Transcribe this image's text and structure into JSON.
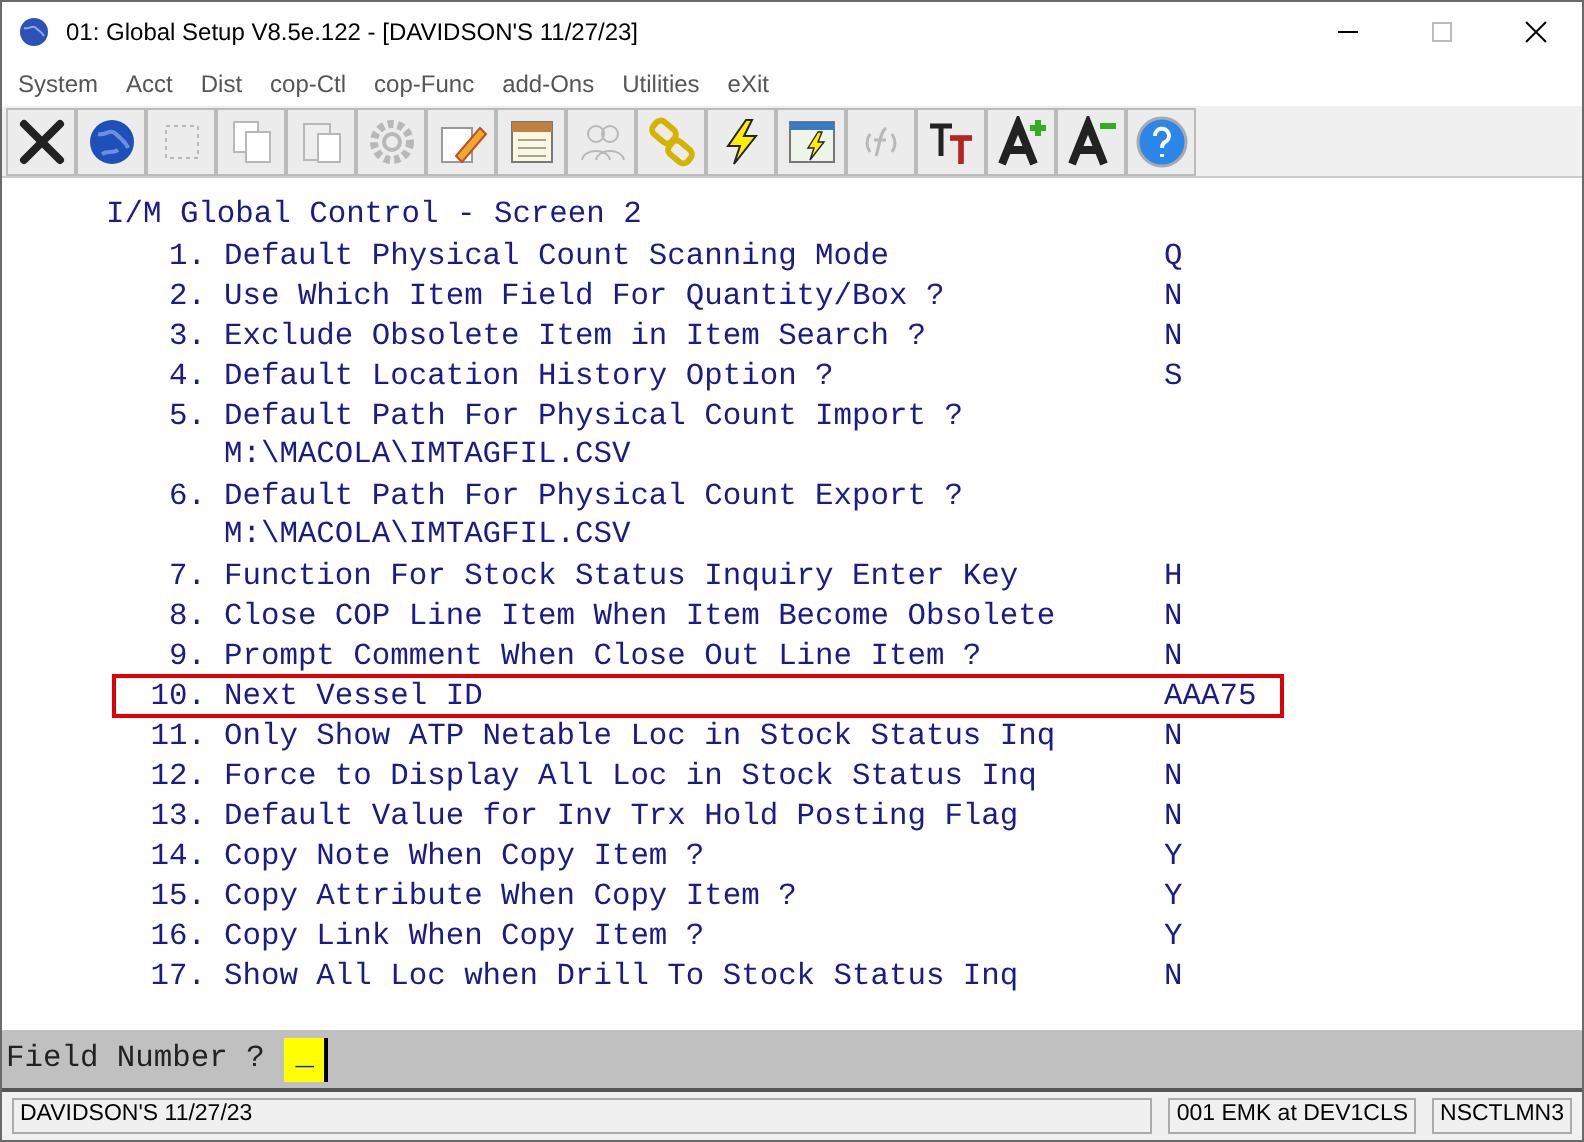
{
  "window": {
    "title": "01: Global Setup V8.5e.122 - [DAVIDSON'S 11/27/23]"
  },
  "menu": [
    "System",
    "Acct",
    "Dist",
    "cop-Ctl",
    "cop-Func",
    "add-Ons",
    "Utilities",
    "eXit"
  ],
  "toolbar": [
    {
      "kind": "close",
      "disabled": false
    },
    {
      "kind": "globe",
      "disabled": false
    },
    {
      "kind": "select",
      "disabled": true
    },
    {
      "kind": "copy",
      "disabled": true
    },
    {
      "kind": "paste",
      "disabled": true
    },
    {
      "kind": "gear",
      "disabled": true
    },
    {
      "kind": "edit",
      "disabled": false
    },
    {
      "kind": "list",
      "disabled": false
    },
    {
      "kind": "users",
      "disabled": true
    },
    {
      "kind": "link",
      "disabled": false
    },
    {
      "kind": "bolt",
      "disabled": false
    },
    {
      "kind": "window-bolt",
      "disabled": false
    },
    {
      "kind": "function",
      "disabled": true
    },
    {
      "kind": "font",
      "disabled": false
    },
    {
      "kind": "font-up",
      "disabled": false
    },
    {
      "kind": "font-down",
      "disabled": false
    },
    {
      "kind": "help",
      "disabled": false
    }
  ],
  "screen": {
    "title": "I/M Global Control - Screen 2",
    "fields": [
      {
        "number": "1.",
        "label": "Default Physical Count Scanning Mode",
        "value": "Q",
        "highlighted": false
      },
      {
        "number": "2.",
        "label": "Use Which Item Field For Quantity/Box ?",
        "value": "N",
        "highlighted": false
      },
      {
        "number": "3.",
        "label": "Exclude Obsolete Item in Item Search ?",
        "value": "N",
        "highlighted": false
      },
      {
        "number": "4.",
        "label": "Default Location History Option ?",
        "value": "S",
        "highlighted": false
      },
      {
        "number": "5.",
        "label": "Default Path For Physical Count Import ?",
        "path": "M:\\MACOLA\\IMTAGFIL.CSV",
        "highlighted": false
      },
      {
        "number": "6.",
        "label": "Default Path For Physical Count Export ?",
        "path": "M:\\MACOLA\\IMTAGFIL.CSV",
        "highlighted": false
      },
      {
        "number": "7.",
        "label": "Function For Stock Status Inquiry Enter Key",
        "value": "H",
        "highlighted": false
      },
      {
        "number": "8.",
        "label": "Close COP Line Item When Item Become Obsolete",
        "value": "N",
        "highlighted": false
      },
      {
        "number": "9.",
        "label": "Prompt Comment When Close Out Line Item ?",
        "value": "N",
        "highlighted": false
      },
      {
        "number": "10.",
        "label": "Next Vessel ID",
        "value": "AAA75",
        "highlighted": true
      },
      {
        "number": "11.",
        "label": "Only Show ATP Netable Loc in Stock Status Inq",
        "value": "N",
        "highlighted": false
      },
      {
        "number": "12.",
        "label": "Force to Display All Loc in Stock Status Inq",
        "value": "N",
        "highlighted": false
      },
      {
        "number": "13.",
        "label": "Default Value for Inv Trx Hold Posting Flag",
        "value": "N",
        "highlighted": false
      },
      {
        "number": "14.",
        "label": "Copy Note When Copy Item ?",
        "value": "Y",
        "highlighted": false
      },
      {
        "number": "15.",
        "label": "Copy Attribute When Copy Item ?",
        "value": "Y",
        "highlighted": false
      },
      {
        "number": "16.",
        "label": "Copy Link When Copy Item ?",
        "value": "Y",
        "highlighted": false
      },
      {
        "number": "17.",
        "label": "Show All Loc when Drill To Stock Status Inq",
        "value": "N",
        "highlighted": false
      }
    ]
  },
  "prompt": {
    "label": "Field Number ?",
    "cursor": "_"
  },
  "status_bar": [
    "DAVIDSON'S 11/27/23",
    "001 EMK at DEV1CLS",
    "NSCTLMN3"
  ]
}
